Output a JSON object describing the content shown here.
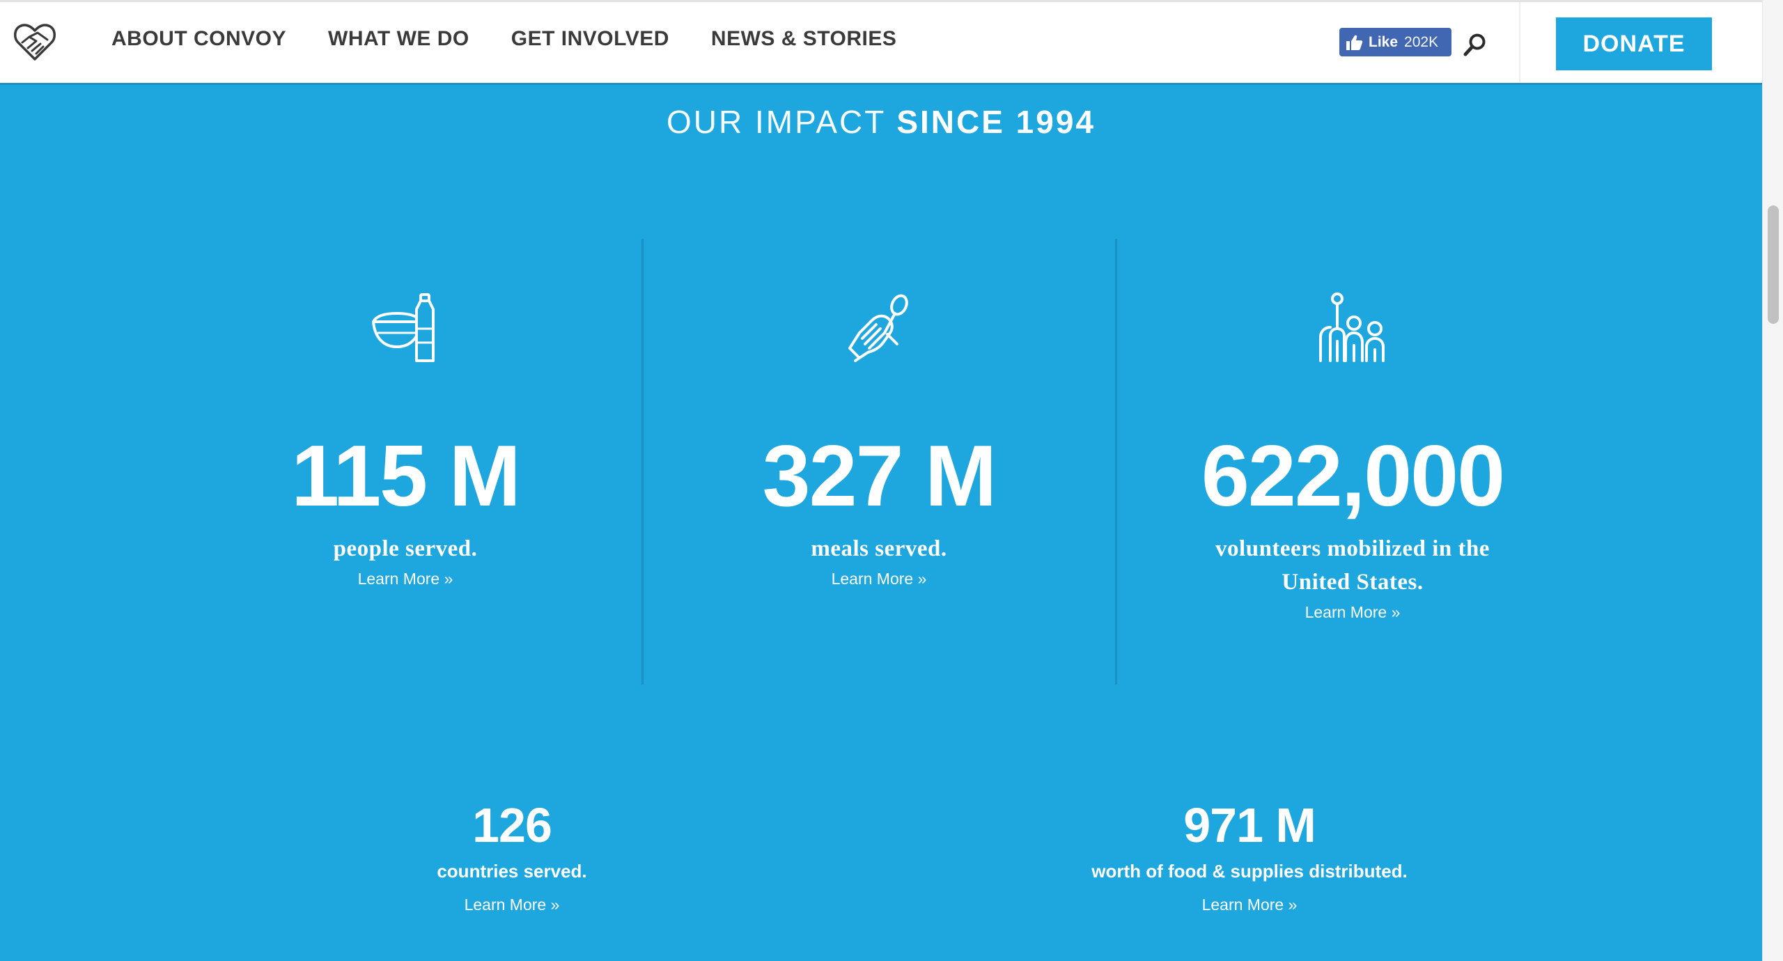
{
  "header": {
    "logo_icon": "heart-handshake-icon",
    "nav": [
      {
        "label": "ABOUT CONVOY"
      },
      {
        "label": "WHAT WE DO"
      },
      {
        "label": "GET INVOLVED"
      },
      {
        "label": "NEWS & STORIES"
      }
    ],
    "facebook": {
      "like_label": "Like",
      "count": "202K"
    },
    "search_icon": "search-icon",
    "donate_label": "DONATE"
  },
  "impact": {
    "title_light": "OUR IMPACT",
    "title_bold": "SINCE 1994",
    "stats": [
      {
        "icon": "bowl-bottle-icon",
        "number": "115 M",
        "label": "people served.",
        "link": "Learn More »"
      },
      {
        "icon": "hand-spoon-icon",
        "number": "327 M",
        "label": "meals served.",
        "link": "Learn More »"
      },
      {
        "icon": "volunteers-icon",
        "number": "622,000",
        "label_line1": "volunteers mobilized in the",
        "label_line2": "United States.",
        "link": "Learn More »"
      }
    ],
    "secondary": [
      {
        "number": "126",
        "label": "countries served.",
        "link": "Learn More »"
      },
      {
        "number": "971 M",
        "label": "worth of food & supplies distributed.",
        "link": "Learn More »"
      }
    ]
  },
  "colors": {
    "brand_blue": "#1ea6de",
    "divider_blue": "#1990c6",
    "header_bg": "#ffffff",
    "nav_text": "#3a3a3a",
    "facebook_blue": "#4267b2"
  }
}
